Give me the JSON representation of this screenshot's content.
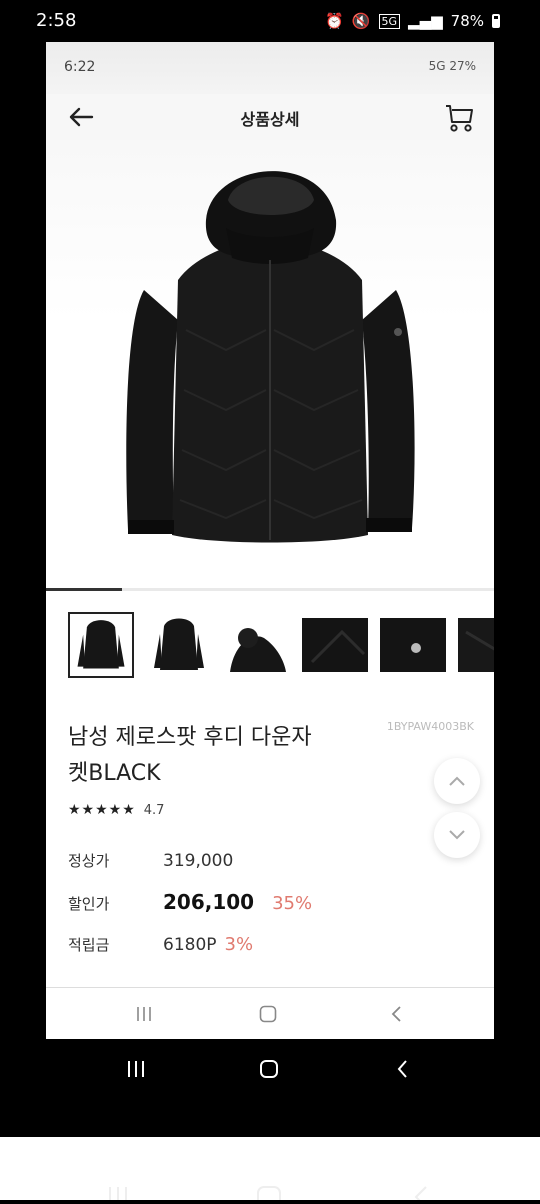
{
  "outer_status": {
    "time": "2:58",
    "battery": "78%",
    "network": "5G"
  },
  "inner_status": {
    "time": "6:22",
    "right_text": "5G 27%"
  },
  "header": {
    "title": "상품상세"
  },
  "gallery": {
    "progress": 0.17,
    "thumb_count": 6
  },
  "product": {
    "name_line1": "남성 제로스팟 후디 다운자",
    "name_line2": "켓BLACK",
    "code": "1BYPAW4003BK",
    "rating": "4.7",
    "stars": "★★★★★"
  },
  "prices": {
    "normal_label": "정상가",
    "normal_value": "319,000",
    "sale_label": "할인가",
    "sale_value": "206,100",
    "sale_pct": "35%",
    "points_label": "적립금",
    "points_value": "6180P",
    "points_pct": "3%"
  },
  "colors": {
    "accent": "#e07a6f",
    "text": "#222222"
  },
  "icons": [
    "back-arrow-icon",
    "cart-icon",
    "scroll-up-icon",
    "scroll-down-icon",
    "recent-apps-icon",
    "home-icon",
    "back-nav-icon"
  ]
}
